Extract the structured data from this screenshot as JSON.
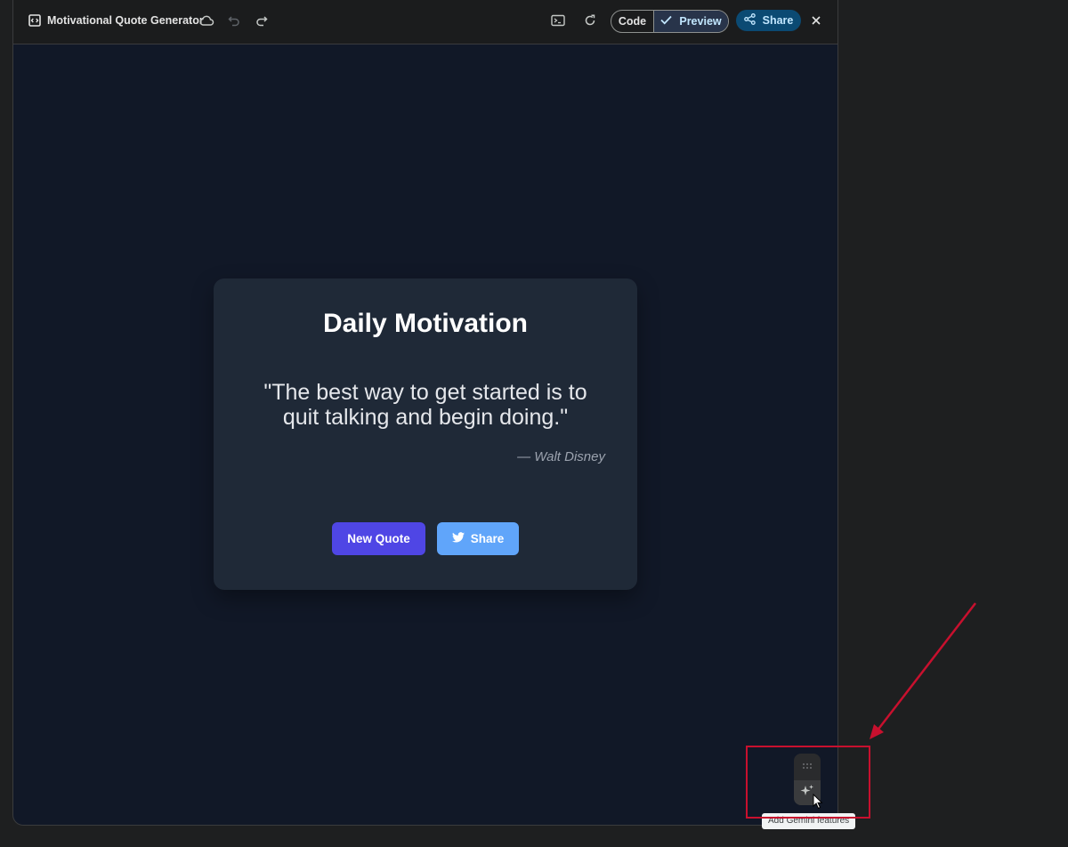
{
  "app": {
    "title": "Motivational Quote Generator",
    "icons": {
      "app": "code-box-icon",
      "cloud": "cloud-save-icon",
      "undo": "undo-icon",
      "redo": "redo-icon",
      "console": "terminal-icon",
      "refresh": "refresh-icon",
      "check": "check-icon",
      "share": "share-icon",
      "close": "close-icon"
    },
    "view_toggle": {
      "code_label": "Code",
      "preview_label": "Preview",
      "selected": "Preview"
    },
    "share_label": "Share"
  },
  "preview": {
    "card": {
      "title": "Daily Motivation",
      "quote": "\"The best way to get started is to quit talking and begin doing.\"",
      "author": "— Walt Disney",
      "new_quote_label": "New Quote",
      "share_label": "Share",
      "share_icon": "twitter-bird-icon"
    },
    "colors": {
      "page_bg": "#111827",
      "card_bg": "#1f2937",
      "primary_button": "#4f46e5",
      "share_button": "#60a5fa"
    }
  },
  "floating_toolbar": {
    "drag_icon": "drag-handle-icon",
    "gemini_icon": "sparkle-icon",
    "tooltip": "Add Gemini features"
  },
  "annotation": {
    "color": "#c8102e"
  }
}
